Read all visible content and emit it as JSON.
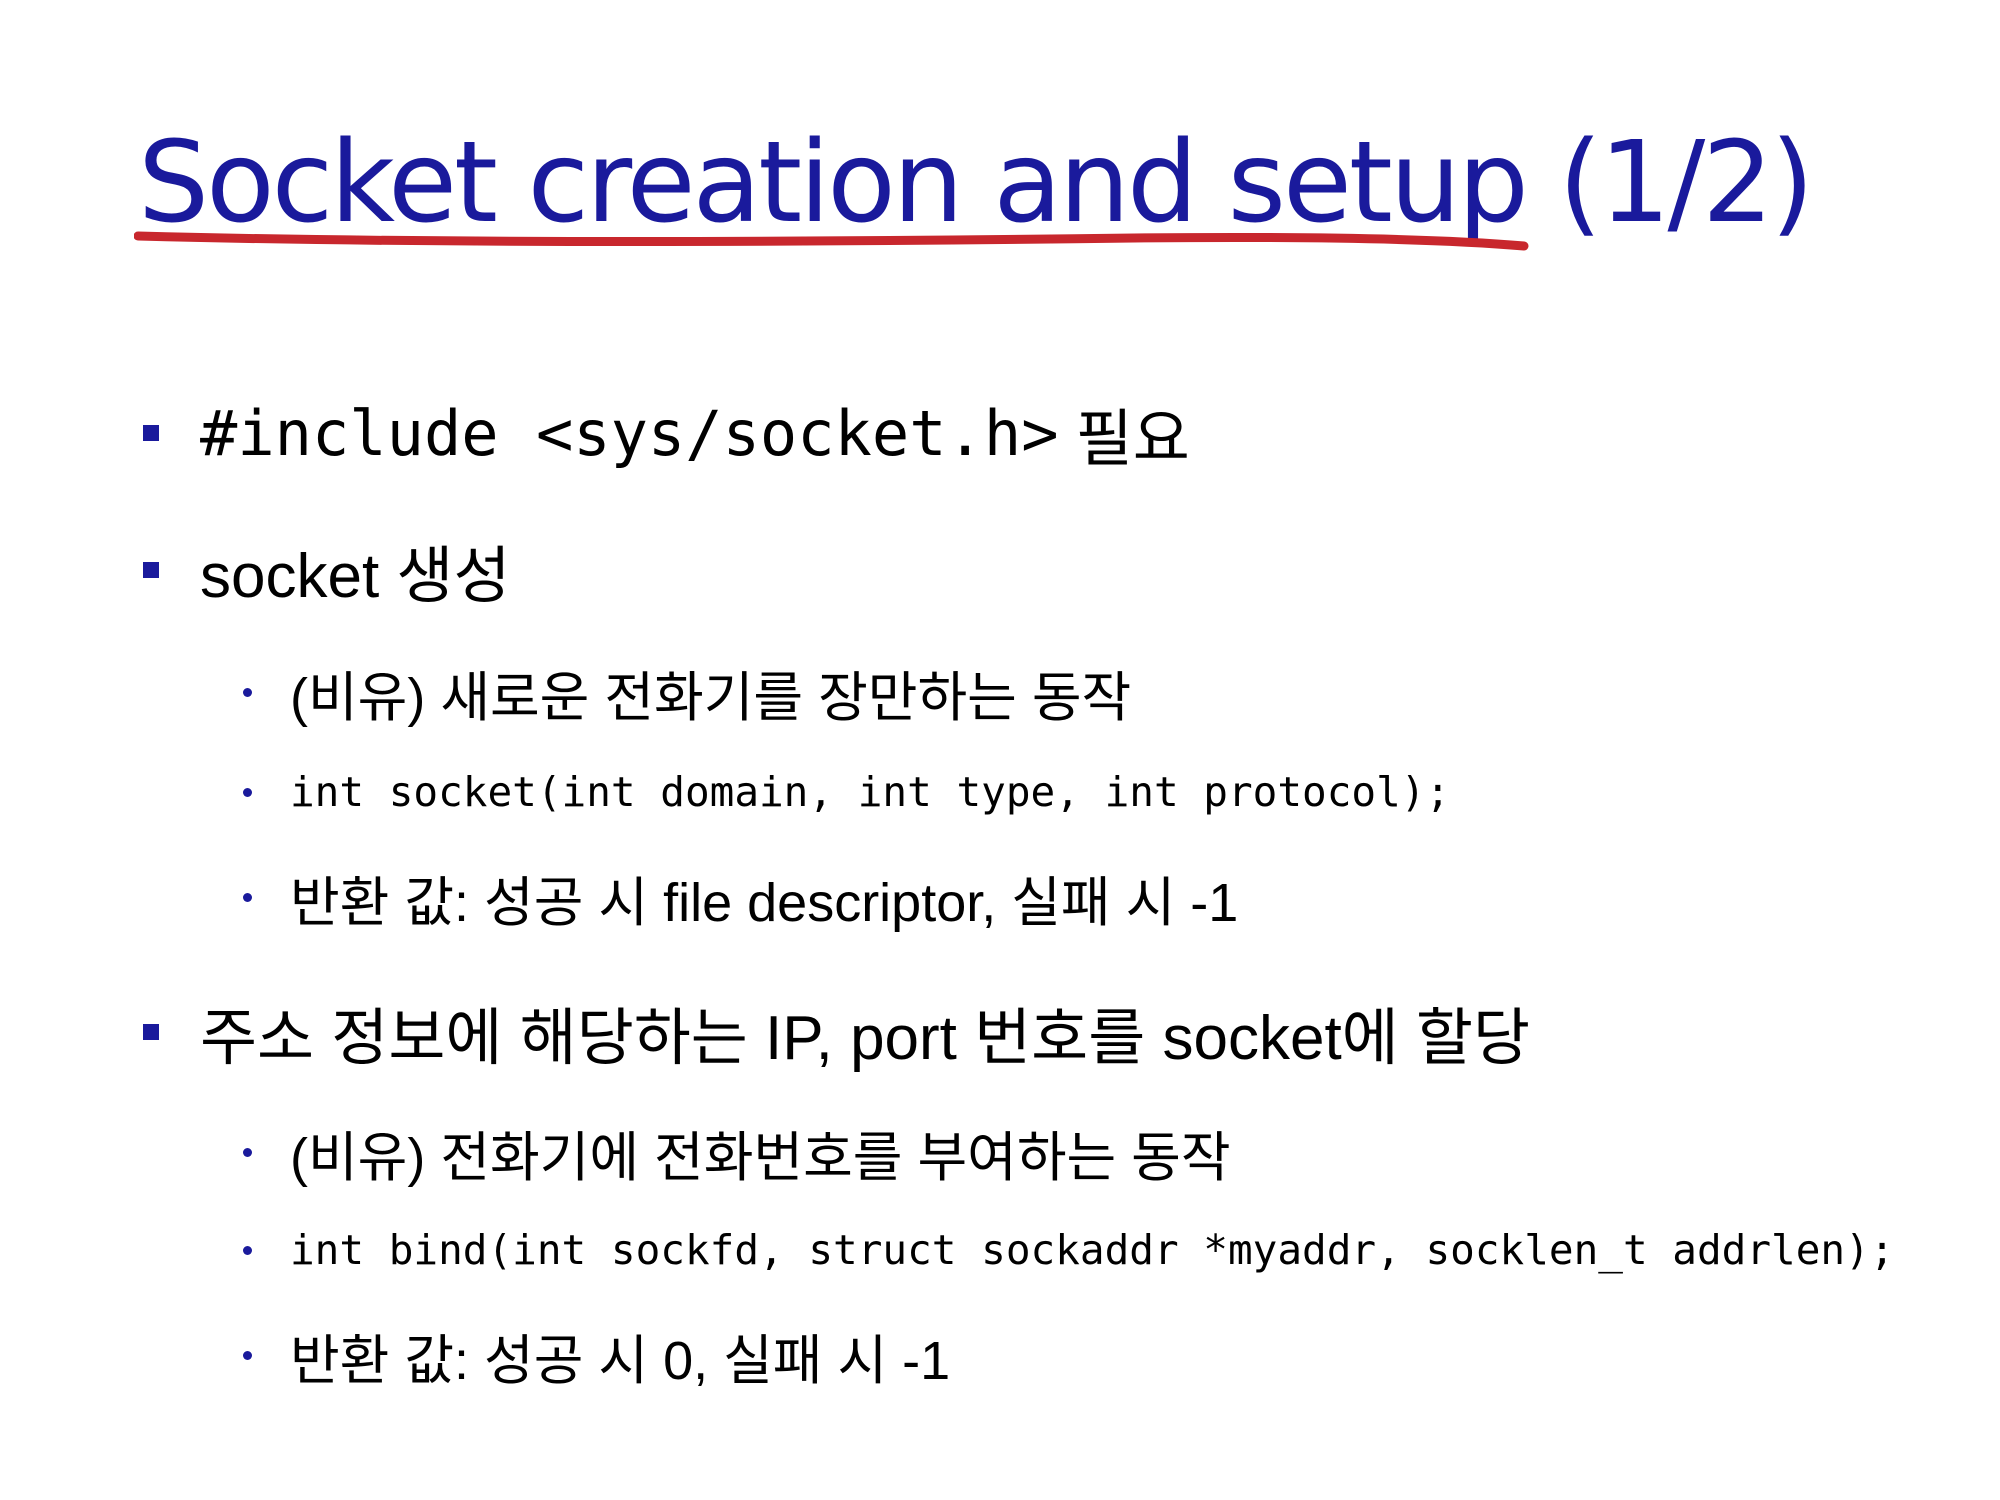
{
  "slide": {
    "title": "Socket creation and setup (1/2)",
    "accent_color": "#1a1a9c",
    "underline_color": "#c8272d",
    "items": [
      {
        "level": 1,
        "code": "#include <sys/socket.h>",
        "text": " 필요"
      },
      {
        "level": 1,
        "text": "socket 생성"
      },
      {
        "level": 2,
        "text": "(비유) 새로운 전화기를 장만하는 동작"
      },
      {
        "level": 2,
        "code": "int socket(int domain, int type, int protocol);"
      },
      {
        "level": 2,
        "text": "반환 값: 성공 시 file descriptor, 실패 시 -1"
      },
      {
        "level": 1,
        "text": "주소 정보에 해당하는 IP, port 번호를 socket에 할당"
      },
      {
        "level": 2,
        "text": "(비유) 전화기에 전화번호를 부여하는 동작"
      },
      {
        "level": 2,
        "code": "int bind(int sockfd, struct sockaddr *myaddr, socklen_t addrlen);"
      },
      {
        "level": 2,
        "text": "반환 값: 성공 시 0, 실패 시 -1"
      }
    ]
  }
}
